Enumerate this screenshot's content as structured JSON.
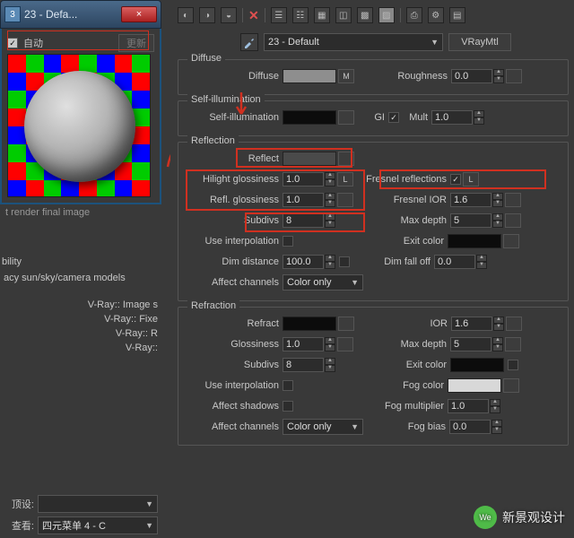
{
  "window": {
    "title": "23 - Defa...",
    "close": "×"
  },
  "sample": {
    "auto": "自动",
    "update": "更新",
    "hint": "t render final image"
  },
  "left": {
    "bility": "bility",
    "legacy": "acy sun/sky/camera models",
    "items": [
      "V-Ray:: Image s",
      "V-Ray:: Fixe",
      "V-Ray:: R",
      "V-Ray:: "
    ],
    "preset_lbl": "顶设:",
    "view_lbl": "查看:",
    "view_val": "四元菜单 4 - C"
  },
  "mat": {
    "name": "23 - Default",
    "type": "VRayMtl"
  },
  "diffuse": {
    "title": "Diffuse",
    "diffuse_lbl": "Diffuse",
    "m": "M",
    "rough_lbl": "Roughness",
    "rough_val": "0.0"
  },
  "selfillum": {
    "title": "Self-illumination",
    "lbl": "Self-illumination",
    "gi": "GI",
    "mult_lbl": "Mult",
    "mult_val": "1.0"
  },
  "reflection": {
    "title": "Reflection",
    "reflect_lbl": "Reflect",
    "hilight_lbl": "Hilight glossiness",
    "hilight_val": "1.0",
    "l": "L",
    "fresnel_lbl": "Fresnel reflections",
    "l2": "L",
    "rglos_lbl": "Refl. glossiness",
    "rglos_val": "1.0",
    "fior_lbl": "Fresnel IOR",
    "fior_val": "1.6",
    "subdiv_lbl": "Subdivs",
    "subdiv_val": "8",
    "maxdepth_lbl": "Max depth",
    "maxdepth_val": "5",
    "useinterp_lbl": "Use interpolation",
    "exit_lbl": "Exit color",
    "dimdist_lbl": "Dim distance",
    "dimdist_val": "100.0",
    "dimfall_lbl": "Dim fall off",
    "dimfall_val": "0.0",
    "affect_lbl": "Affect channels",
    "affect_val": "Color only"
  },
  "refraction": {
    "title": "Refraction",
    "refract_lbl": "Refract",
    "ior_lbl": "IOR",
    "ior_val": "1.6",
    "gloss_lbl": "Glossiness",
    "gloss_val": "1.0",
    "maxdepth_lbl": "Max depth",
    "maxdepth_val": "5",
    "subdiv_lbl": "Subdivs",
    "subdiv_val": "8",
    "exit_lbl": "Exit color",
    "useinterp_lbl": "Use interpolation",
    "fogcolor_lbl": "Fog color",
    "affshadow_lbl": "Affect shadows",
    "fogmult_lbl": "Fog multiplier",
    "fogmult_val": "1.0",
    "affect_lbl": "Affect channels",
    "affect_val": "Color only",
    "fogbias_lbl": "Fog bias",
    "fogbias_val": "0.0"
  },
  "watermark": "新景观设计"
}
